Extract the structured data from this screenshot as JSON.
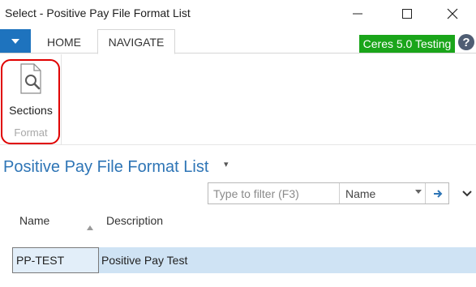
{
  "window": {
    "title": "Select - Positive Pay File Format List"
  },
  "ribbon": {
    "tabs": [
      {
        "label": "HOME"
      },
      {
        "label": "NAVIGATE"
      }
    ],
    "active_tab": "NAVIGATE",
    "company_badge": "Ceres 5.0 Testing",
    "help_label": "?",
    "groups": [
      {
        "label": "Format",
        "buttons": [
          {
            "label": "Sections",
            "icon": "document-magnifier-icon"
          }
        ]
      }
    ]
  },
  "page": {
    "title": "Positive Pay File Format List",
    "title_caret": "▾"
  },
  "filter": {
    "placeholder": "Type to filter (F3)",
    "value": "",
    "field": "Name"
  },
  "table": {
    "columns": [
      {
        "label": "Name"
      },
      {
        "label": "Description"
      }
    ],
    "rows": [
      {
        "name": "PP-TEST",
        "description": "Positive Pay Test"
      }
    ]
  },
  "colors": {
    "accent": "#2e75b6",
    "app_menu": "#1e73be",
    "badge": "#1aa51a",
    "selected_row": "#cfe3f4",
    "highlight": "#e00000"
  }
}
